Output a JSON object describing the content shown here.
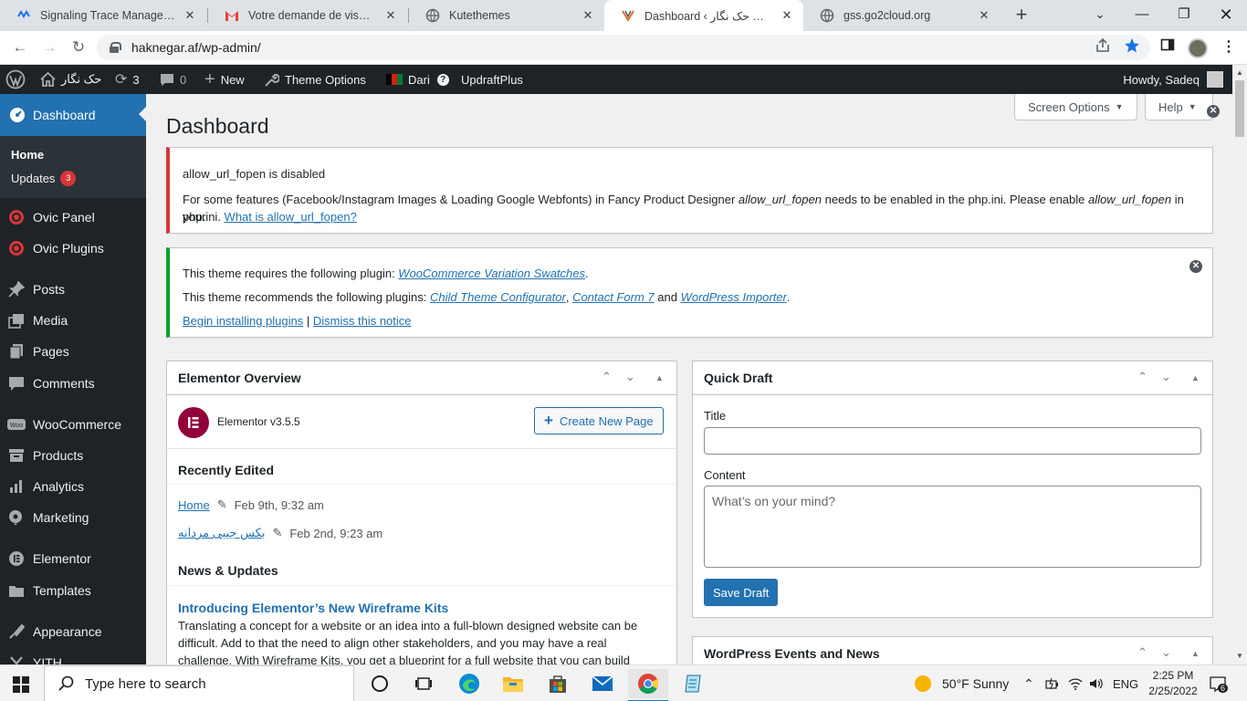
{
  "browser": {
    "tabs": [
      {
        "title": "Signaling Trace Management",
        "icon": "signaling-favicon"
      },
      {
        "title": "Votre demande de visa / Uw",
        "icon": "gmail-favicon"
      },
      {
        "title": "Kutethemes",
        "icon": "globe-favicon"
      },
      {
        "title": "Dashboard ‹ حک نگار — Word",
        "icon": "wordpress-favicon"
      },
      {
        "title": "gss.go2cloud.org",
        "icon": "globe-favicon"
      }
    ],
    "url": "haknegar.af/wp-admin/"
  },
  "adminbar": {
    "site_name": "حک نگار",
    "updates_count": "3",
    "comments_count": "0",
    "new_label": "New",
    "theme_options_label": "Theme Options",
    "language_label": "Dari",
    "updraft_label": "UpdraftPlus",
    "howdy": "Howdy, Sadeq"
  },
  "sidebar": {
    "dashboard_label": "Dashboard",
    "submenu": [
      {
        "label": "Home"
      },
      {
        "label": "Updates",
        "badge": "3"
      }
    ],
    "items": [
      {
        "label": "Ovic Panel",
        "icon": "ovic-icon"
      },
      {
        "label": "Ovic Plugins",
        "icon": "ovic-icon"
      },
      {
        "label": "Posts",
        "icon": "pin-icon"
      },
      {
        "label": "Media",
        "icon": "media-icon"
      },
      {
        "label": "Pages",
        "icon": "pages-icon"
      },
      {
        "label": "Comments",
        "icon": "comment-icon"
      },
      {
        "label": "WooCommerce",
        "icon": "woocommerce-icon"
      },
      {
        "label": "Products",
        "icon": "products-icon"
      },
      {
        "label": "Analytics",
        "icon": "analytics-icon"
      },
      {
        "label": "Marketing",
        "icon": "marketing-icon"
      },
      {
        "label": "Elementor",
        "icon": "elementor-icon"
      },
      {
        "label": "Templates",
        "icon": "templates-icon"
      },
      {
        "label": "Appearance",
        "icon": "appearance-icon"
      },
      {
        "label": "YITH",
        "icon": "yith-icon"
      }
    ]
  },
  "main": {
    "page_title": "Dashboard",
    "screen_options_label": "Screen Options",
    "help_label": "Help",
    "notice_error": {
      "heading": "allow_url_fopen is disabled",
      "text_1": "For some features (Facebook/Instagram Images & Loading Google Webfonts) in Fancy Product Designer ",
      "em_1": "allow_url_fopen",
      "text_2": " needs to be enabled in the php.ini. Please enable ",
      "em_2": "allow_url_fopen",
      "text_3": " in your",
      "text_4": "php.ini. ",
      "link": "What is allow_url_fopen?"
    },
    "notice_plugins": {
      "requires_text": "This theme requires the following plugin: ",
      "requires_link": "WooCommerce Variation Swatches",
      "recommends_text": "This theme recommends the following plugins: ",
      "rec_link_1": "Child Theme Configurator",
      "rec_link_2": "Contact Form 7",
      "and_text": " and ",
      "rec_link_3": "WordPress Importer",
      "begin_link": "Begin installing plugins",
      "sep": " | ",
      "dismiss_link": "Dismiss this notice"
    },
    "elementor_box": {
      "title": "Elementor Overview",
      "version": "Elementor v3.5.5",
      "create_button": "Create New Page",
      "recently_edited_title": "Recently Edited",
      "recent": [
        {
          "name": "Home",
          "date": "Feb 9th, 9:32 am"
        },
        {
          "name": "بکس جیبی مردانه",
          "date": "Feb 2nd, 9:23 am"
        }
      ],
      "news_title": "News & Updates",
      "news_link": "Introducing Elementor’s New Wireframe Kits",
      "news_text": "Translating a concept for a website or an idea into a full-blown designed website can be difficult. Add to that the need to align other stakeholders, and you may have a real challenge. With Wireframe Kits, you get a blueprint for a full website that you can build"
    },
    "quick_draft": {
      "title": "Quick Draft",
      "title_label": "Title",
      "title_value": "",
      "content_label": "Content",
      "content_placeholder": "What’s on your mind?",
      "save_button": "Save Draft"
    },
    "events_box": {
      "title": "WordPress Events and News"
    }
  },
  "taskbar": {
    "search_placeholder": "Type here to search",
    "weather": "50°F  Sunny",
    "lang": "ENG",
    "time": "2:25 PM",
    "date": "2/25/2022",
    "notif_count": "6"
  },
  "colors": {
    "wp_dark": "#1d2327",
    "wp_blue": "#2271b1",
    "error_red": "#d63638",
    "success_green": "#00a32a",
    "elementor": "#92003b"
  }
}
